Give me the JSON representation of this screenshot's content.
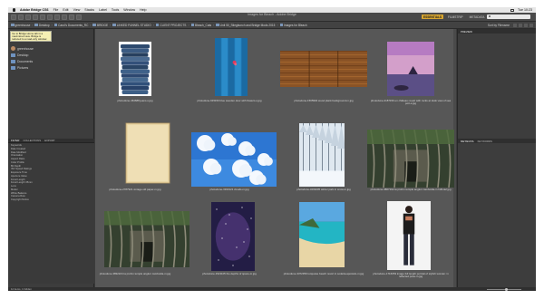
{
  "menubar": {
    "app_name": "Adobe Bridge CS6",
    "items": [
      "File",
      "Edit",
      "View",
      "Stacks",
      "Label",
      "Tools",
      "Window",
      "Help"
    ],
    "clock": "Tue 10:23"
  },
  "window": {
    "title": "Images for Bleach - Adobe Bridge"
  },
  "workspaces": [
    "ESSENTIALS",
    "FILMSTRIP",
    "METADATA",
    "KEYWORDS"
  ],
  "path": [
    "greenhouse",
    "Desktop",
    "Carol's Documents_RC",
    "BRIDGE",
    "LINKED FUNNEL STUDIO",
    "CLIENT PROJECTS",
    "Bleach_Cats",
    "Unit 50_Stiegbunch and Bridge Mods 2015",
    "Images for Bleach"
  ],
  "sort_label": "Sort by Filename",
  "tooltip": "Go to Bridge Home tab in a maximized view. Bridge is reduced to a read-only window. Click to view in Mini Bridge.",
  "favorites": [
    {
      "label": "greenhouse",
      "icon": "user-avatar-icon"
    },
    {
      "label": "Desktop",
      "icon": "folder-icon"
    },
    {
      "label": "Documents",
      "icon": "folder-icon"
    },
    {
      "label": "Pictures",
      "icon": "folder-icon"
    }
  ],
  "left_tabs": [
    "FILTER",
    "COLLECTIONS",
    "EXPORT"
  ],
  "filters": [
    "Keywords",
    "Date Created",
    "Date Modified",
    "Orientation",
    "Aspect Ratio",
    "Color Profile",
    "Bit Depth",
    "ISO Speed Ratings",
    "Exposure Time",
    "Aperture Value",
    "Focal Length",
    "Focal Length 35mm",
    "Lens",
    "Model",
    "White Balance",
    "Camera Raw",
    "Copyright Notice"
  ],
  "right_tabs": [
    "PREVIEW"
  ],
  "right_meta_tabs": [
    "METADATA",
    "KEYWORDS"
  ],
  "thumbnails": [
    {
      "caption": "photodune-464688 jeans-s.jpg",
      "icon": "jeans-image"
    },
    {
      "caption": "photodune-915150 blue wooden door with flowers-s.jpg",
      "icon": "blue-door-image"
    },
    {
      "caption": "photodune-1565994 wood plank background-m.jpg",
      "icon": "wood-image"
    },
    {
      "caption": "photodune-2187150 en château rouett with rocks at dusk view of sea port-s.jpg",
      "icon": "sea-rocks-image"
    },
    {
      "caption": "photodune-2787921 vintage old paper-m.jpg",
      "icon": "paper-image"
    },
    {
      "caption": "photodune-3193121 clouds-m.jpg",
      "icon": "clouds-image"
    },
    {
      "caption": "photodune-3299205 winter park in snow-m.jpg",
      "icon": "snow-trees-image"
    },
    {
      "caption": "photodune-3867162 ta prohm temple angkor cambodia-m hdhotel.jpg",
      "icon": "temple-image"
    },
    {
      "caption": "photodune-3832224 ta prohm temple angkor cambodia-m.jpg",
      "icon": "temple-ruins-image"
    },
    {
      "caption": "photodune-3321105 the depths of space-m.jpg",
      "icon": "space-image"
    },
    {
      "caption": "photodune-3372359 turquoise beach resort in sodetia-apostolo-m.jpg",
      "icon": "beach-image"
    },
    {
      "caption": "photodune-1716053 image full length portrait of stylish woman i n reflected pose-m.jpg",
      "icon": "woman-image"
    }
  ],
  "status": "12 items, 1 hidden"
}
